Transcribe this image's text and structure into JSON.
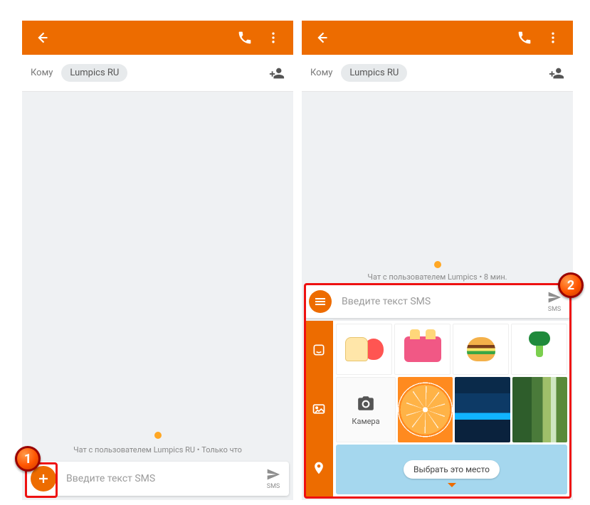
{
  "colors": {
    "accent": "#ed6c00"
  },
  "markers": {
    "one": "1",
    "two": "2"
  },
  "common": {
    "to_label": "Кому",
    "recipient": "Lumpics RU",
    "input_placeholder": "Введите текст SMS",
    "send_label": "SMS"
  },
  "left": {
    "status_line": "Чат с пользователем Lumpics RU • Только что"
  },
  "right": {
    "status_line": "Чат с пользователем Lumpics • 8 мин.",
    "side_tabs": [
      {
        "name": "stickers-tab"
      },
      {
        "name": "gallery-tab"
      },
      {
        "name": "location-tab"
      }
    ],
    "stickers": [
      {
        "name": "toast-apple-sticker"
      },
      {
        "name": "toaster-sticker"
      },
      {
        "name": "burger-sticker"
      },
      {
        "name": "broccoli-sticker"
      }
    ],
    "camera_label": "Камера",
    "photos": [
      {
        "name": "orange-slice-photo"
      },
      {
        "name": "bioluminescence-photo"
      },
      {
        "name": "waterfall-photo"
      }
    ],
    "place_label": "Выбрать это место"
  }
}
